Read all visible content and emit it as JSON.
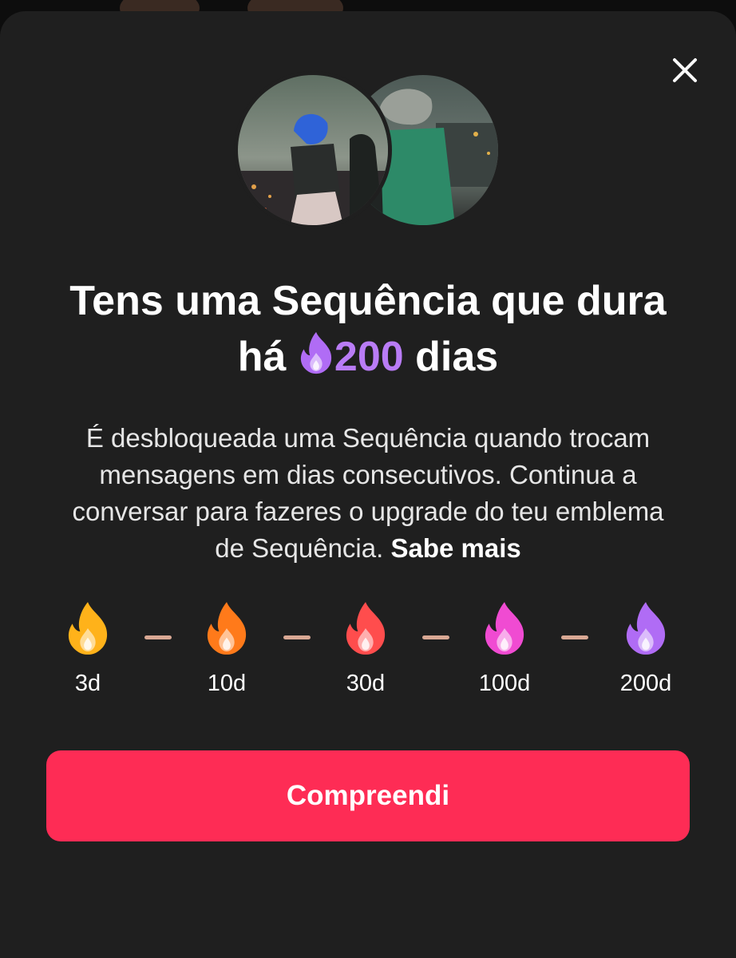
{
  "dialog": {
    "title_before": "Tens uma Sequência que dura há",
    "streak_count": "200",
    "title_after": "dias",
    "description": "É desbloqueada uma Sequência quando trocam mensagens em dias consecutivos. Continua a conversar para fazeres o upgrade do teu emblema de Sequência.",
    "learn_more": "Sabe mais",
    "close_icon": "close-icon",
    "inline_icon": "flame-icon-purple"
  },
  "tiers": [
    {
      "label": "3d",
      "icon": "flame-icon-yellow",
      "color": "#ffb21a"
    },
    {
      "label": "10d",
      "icon": "flame-icon-orange",
      "color": "#ff7a1a"
    },
    {
      "label": "30d",
      "icon": "flame-icon-red",
      "color": "#ff4d4d"
    },
    {
      "label": "100d",
      "icon": "flame-icon-pink",
      "color": "#f04bd2"
    },
    {
      "label": "200d",
      "icon": "flame-icon-purple",
      "color": "#b06cf5"
    }
  ],
  "cta": {
    "label": "Compreendi"
  },
  "colors": {
    "sheet_bg": "#1f1f1f",
    "accent": "#fe2c55",
    "streak_purple": "#b97cf6",
    "dash": "#d9a894"
  }
}
